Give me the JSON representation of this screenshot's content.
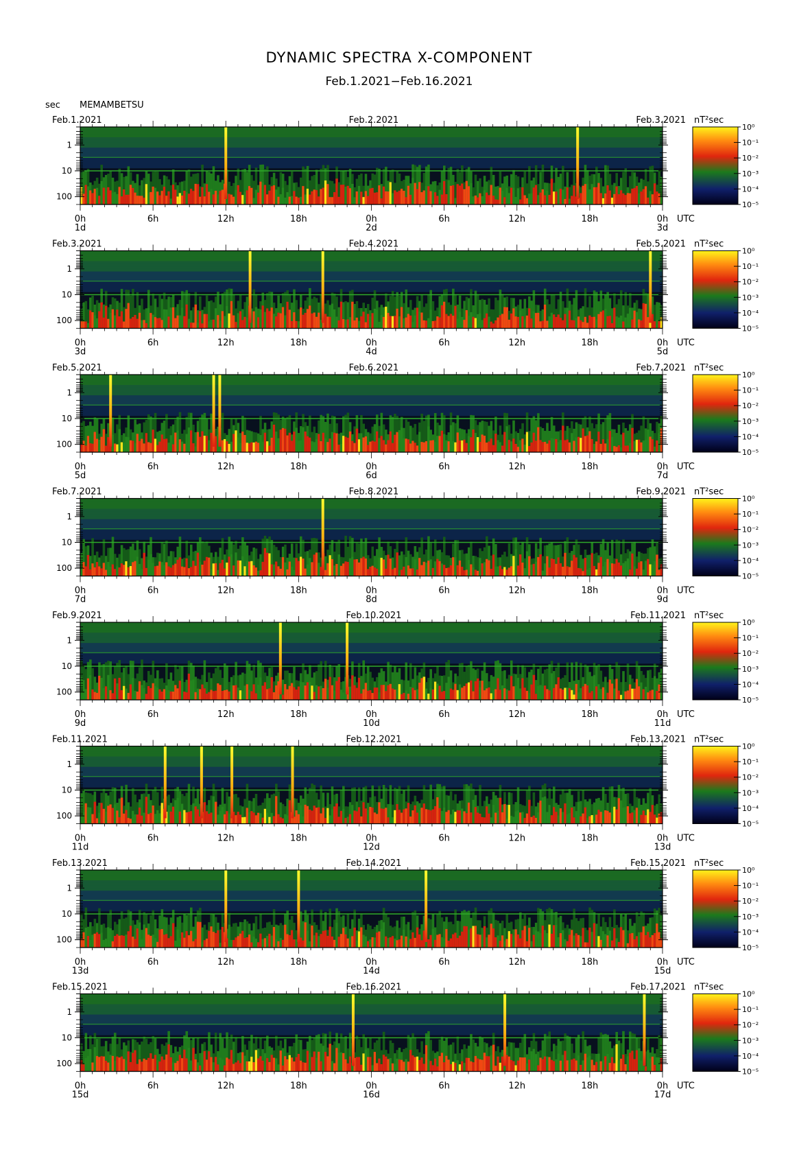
{
  "title": "DYNAMIC SPECTRA X-COMPONENT",
  "subtitle": "Feb.1.2021−Feb.16.2021",
  "station": "MEMAMBETSU",
  "y_unit": "sec",
  "time_unit": "UTC",
  "colorbar_unit": "nT²sec",
  "colorbar_ticks": [
    "10⁰",
    "10⁻¹",
    "10⁻²",
    "10⁻³",
    "10⁻⁴",
    "10⁻⁵"
  ],
  "colors": {
    "background": "#0a0a1e",
    "low": "#0f1f55",
    "mid": "#1e7a1e",
    "high": "#e82a10",
    "peak": "#ffe21a"
  },
  "chart_data": {
    "type": "heatmap",
    "x_ticks": [
      "0h",
      "6h",
      "12h",
      "18h",
      "0h",
      "6h",
      "12h",
      "18h",
      "0h"
    ],
    "y_ticks": [
      "1",
      "10",
      "100"
    ],
    "y_scale": "log",
    "y_range_sec": [
      0.2,
      200
    ],
    "colorscale": "log",
    "value_range_nT2sec": [
      1e-05,
      1
    ],
    "panels": [
      {
        "date_start": "Feb.1.2021",
        "date_mid": "Feb.2.2021",
        "date_end": "Feb.3.2021",
        "day_start": "1d",
        "day_mid": "2d",
        "day_end": "3d",
        "spikes_hours": [
          12,
          41
        ]
      },
      {
        "date_start": "Feb.3.2021",
        "date_mid": "Feb.4.2021",
        "date_end": "Feb.5.2021",
        "day_start": "3d",
        "day_mid": "4d",
        "day_end": "5d",
        "spikes_hours": [
          14,
          20,
          47
        ]
      },
      {
        "date_start": "Feb.5.2021",
        "date_mid": "Feb.6.2021",
        "date_end": "Feb.7.2021",
        "day_start": "5d",
        "day_mid": "6d",
        "day_end": "7d",
        "spikes_hours": [
          2.5,
          11,
          11.5
        ]
      },
      {
        "date_start": "Feb.7.2021",
        "date_mid": "Feb.8.2021",
        "date_end": "Feb.9.2021",
        "day_start": "7d",
        "day_mid": "8d",
        "day_end": "9d",
        "spikes_hours": [
          20
        ]
      },
      {
        "date_start": "Feb.9.2021",
        "date_mid": "Feb.10.2021",
        "date_end": "Feb.11.2021",
        "day_start": "9d",
        "day_mid": "10d",
        "day_end": "11d",
        "spikes_hours": [
          16.5,
          22
        ]
      },
      {
        "date_start": "Feb.11.2021",
        "date_mid": "Feb.12.2021",
        "date_end": "Feb.13.2021",
        "day_start": "11d",
        "day_mid": "12d",
        "day_end": "13d",
        "spikes_hours": [
          7,
          10,
          12.5,
          17.5
        ]
      },
      {
        "date_start": "Feb.13.2021",
        "date_mid": "Feb.14.2021",
        "date_end": "Feb.15.2021",
        "day_start": "13d",
        "day_mid": "14d",
        "day_end": "15d",
        "spikes_hours": [
          12,
          18,
          28.5
        ]
      },
      {
        "date_start": "Feb.15.2021",
        "date_mid": "Feb.16.2021",
        "date_end": "Feb.17.2021",
        "day_start": "15d",
        "day_mid": "16d",
        "day_end": "17d",
        "spikes_hours": [
          22.5,
          35,
          46.5
        ]
      }
    ]
  }
}
